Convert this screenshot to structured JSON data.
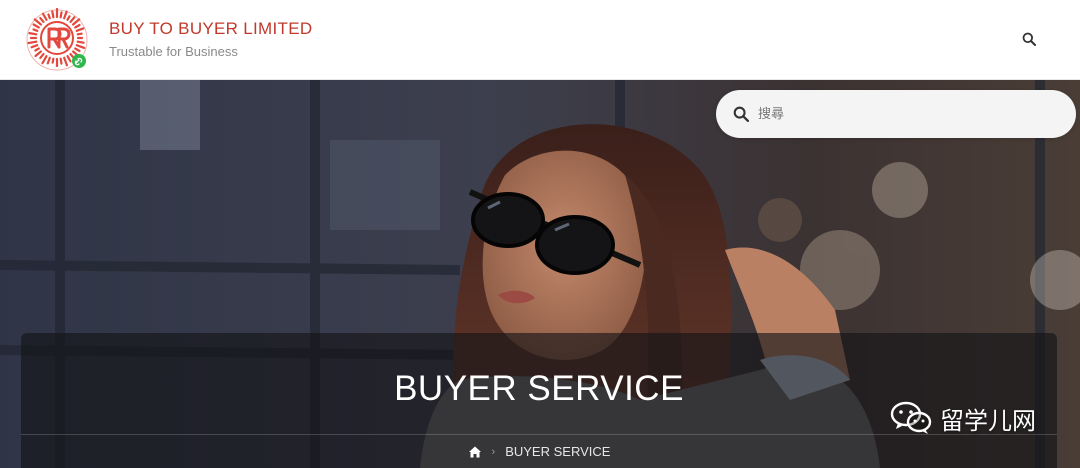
{
  "brand": {
    "title": "BUY TO BUYER LIMITED",
    "tagline": "Trustable for Business",
    "logo_icon": "qr-logo-icon",
    "logo_color": "#e2483d"
  },
  "header": {
    "search_icon": "search-icon"
  },
  "search": {
    "placeholder": "搜尋",
    "value": "",
    "icon": "search-icon"
  },
  "hero": {
    "image": "woman-with-sunglasses-photo",
    "heading": "BUYER SERVICE",
    "breadcrumb": {
      "home_icon": "home-icon",
      "separator": "›",
      "current": "BUYER SERVICE"
    }
  },
  "watermark": {
    "text": "留学儿网",
    "icon": "wechat-icon"
  },
  "colors": {
    "brand_red": "#c0392b",
    "tagline_gray": "#8a8a8a",
    "panel_overlay": "rgba(20,20,22,0.62)"
  }
}
